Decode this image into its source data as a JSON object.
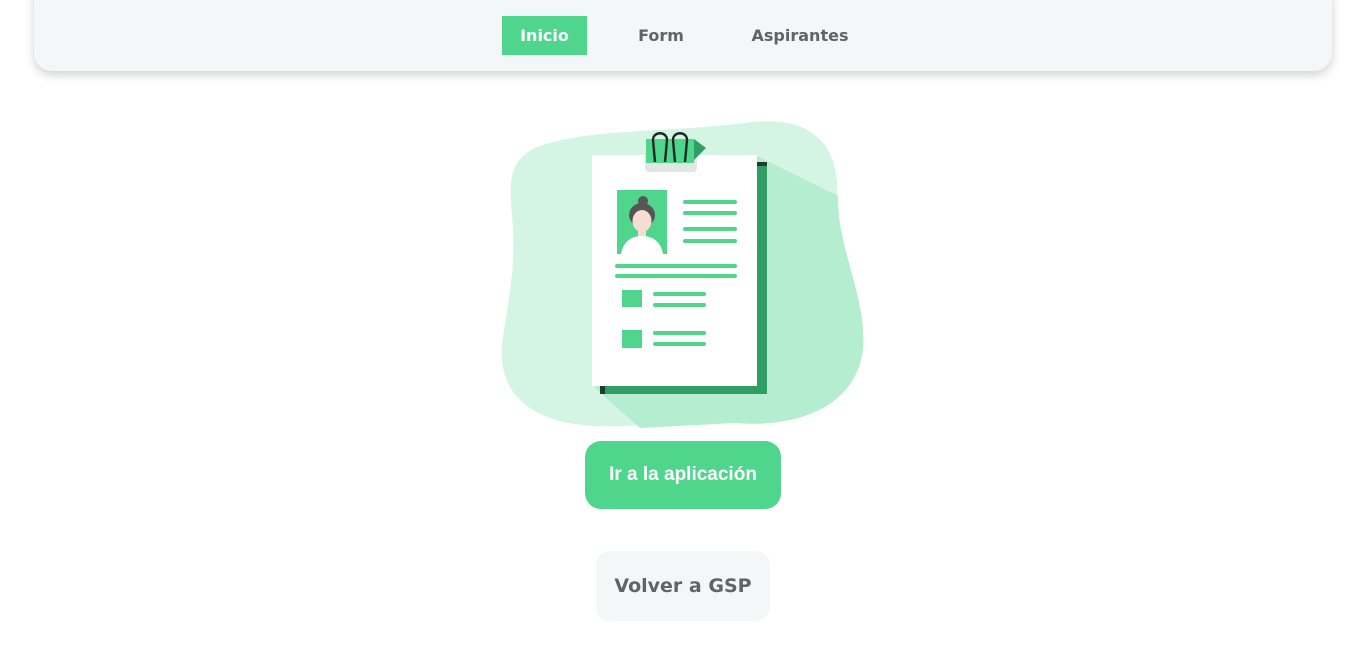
{
  "nav": {
    "items": [
      {
        "label": "Inicio",
        "active": true
      },
      {
        "label": "Form",
        "active": false
      },
      {
        "label": "Aspirantes",
        "active": false
      }
    ]
  },
  "hero": {
    "image_icon": "resume-clipboard-illustration"
  },
  "actions": {
    "primary_label": "Ir a la aplicación",
    "secondary_label": "Volver a GSP"
  },
  "colors": {
    "accent": "#4fd68c",
    "accent_light": "#d4f5e4",
    "nav_bg": "#f4f7f7",
    "text_gray": "#5f6466"
  }
}
